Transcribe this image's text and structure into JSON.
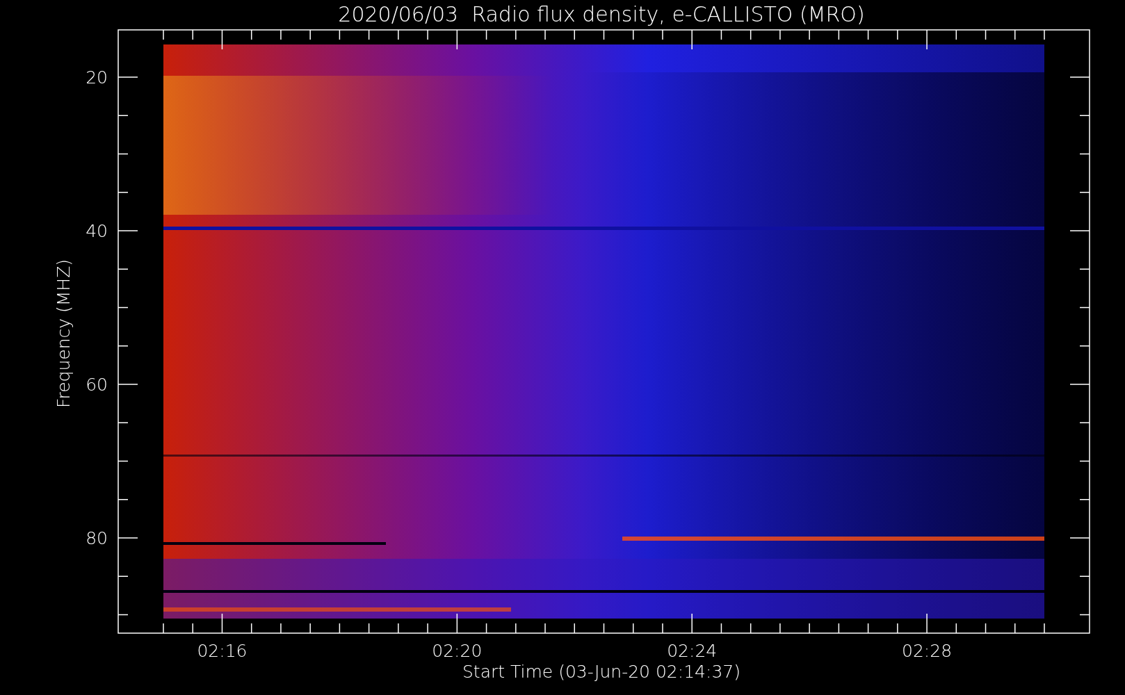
{
  "title": "2020/06/03  Radio flux density, e-CALLISTO (MRO)",
  "ylabel": "Frequency (MHZ)",
  "xlabel": "Start Time (03-Jun-20 02:14:37)",
  "y_ticks": [
    "20",
    "40",
    "60",
    "80"
  ],
  "x_ticks": [
    "02:16",
    "02:20",
    "02:24",
    "02:28"
  ]
}
